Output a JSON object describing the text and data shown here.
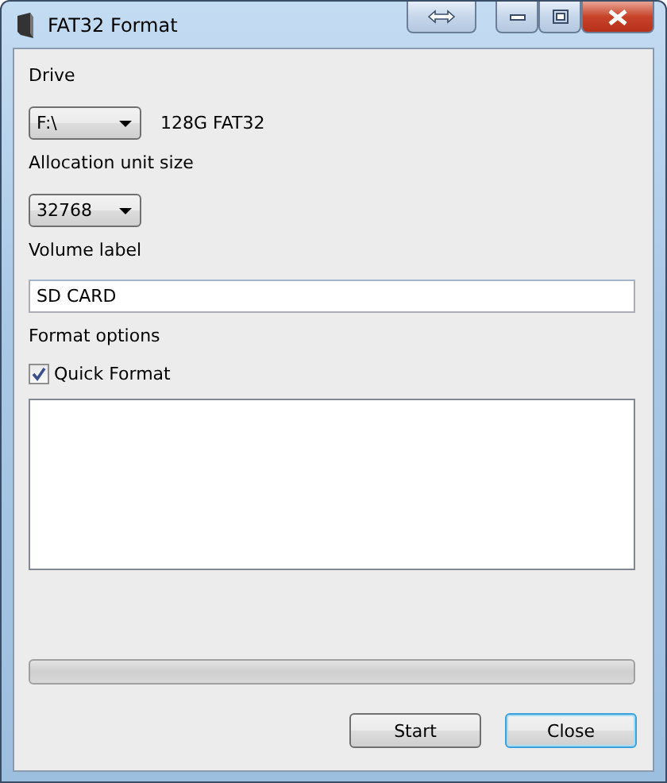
{
  "window": {
    "title": "FAT32 Format"
  },
  "drive": {
    "label": "Drive",
    "value": "F:\\",
    "info": "128G FAT32"
  },
  "allocation": {
    "label": "Allocation unit size",
    "value": "32768"
  },
  "volume": {
    "label": "Volume label",
    "value": "SD CARD"
  },
  "options": {
    "label": "Format options",
    "quick_format": {
      "label": "Quick Format",
      "checked": true
    }
  },
  "progress": {
    "level": 0
  },
  "buttons": [
    {
      "label": "Start",
      "focused": false
    },
    {
      "label": "Close",
      "focused": true
    }
  ]
}
